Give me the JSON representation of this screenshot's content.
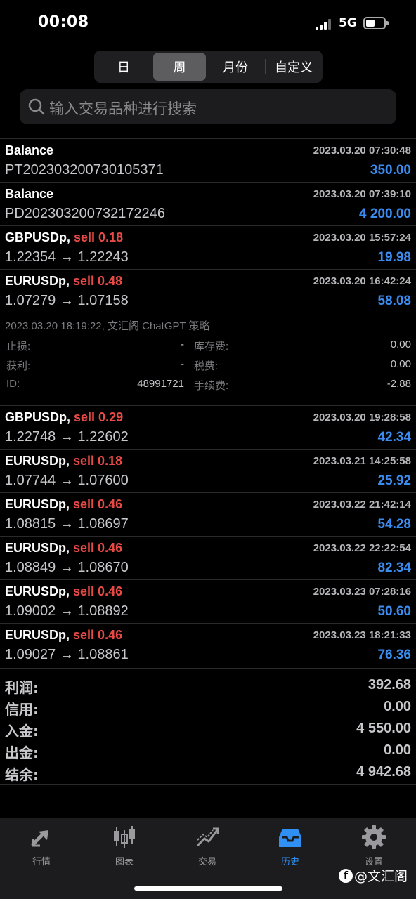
{
  "status": {
    "time": "00:08",
    "network": "5G"
  },
  "segments": [
    {
      "label": "日"
    },
    {
      "label": "周"
    },
    {
      "label": "月份"
    },
    {
      "label": "自定义"
    }
  ],
  "active_segment": "周",
  "search": {
    "placeholder": "输入交易品种进行搜索"
  },
  "rows": [
    {
      "symbol": "Balance",
      "side": "",
      "time": "2023.03.20 07:30:48",
      "sub": "PT202303200730105371",
      "value": "350.00"
    },
    {
      "symbol": "Balance",
      "side": "",
      "time": "2023.03.20 07:39:10",
      "sub": "PD202303200732172246",
      "value": "4 200.00"
    },
    {
      "symbol": "GBPUSDp,",
      "side": "sell 0.18",
      "time": "2023.03.20 15:57:24",
      "sub": "1.22354 → 1.22243",
      "value": "19.98"
    },
    {
      "symbol": "EURUSDp,",
      "side": "sell 0.48",
      "time": "2023.03.20 16:42:24",
      "sub": "1.07279 → 1.07158",
      "value": "58.08"
    }
  ],
  "detail": {
    "time_comment": "2023.03.20 18:19:22, 文汇阁 ChatGPT 策略",
    "sl_label": "止损:",
    "sl_value": "-",
    "swap_label": "库存费:",
    "swap_value": "0.00",
    "tp_label": "获利:",
    "tp_value": "-",
    "tax_label": "税费:",
    "tax_value": "0.00",
    "id_label": "ID:",
    "id_value": "48991721",
    "fee_label": "手续费:",
    "fee_value": "-2.88"
  },
  "rows2": [
    {
      "symbol": "GBPUSDp,",
      "side": "sell 0.29",
      "time": "2023.03.20 19:28:58",
      "sub": "1.22748 → 1.22602",
      "value": "42.34"
    },
    {
      "symbol": "EURUSDp,",
      "side": "sell 0.18",
      "time": "2023.03.21 14:25:58",
      "sub": "1.07744 → 1.07600",
      "value": "25.92"
    },
    {
      "symbol": "EURUSDp,",
      "side": "sell 0.46",
      "time": "2023.03.22 21:42:14",
      "sub": "1.08815 → 1.08697",
      "value": "54.28"
    },
    {
      "symbol": "EURUSDp,",
      "side": "sell 0.46",
      "time": "2023.03.22 22:22:54",
      "sub": "1.08849 → 1.08670",
      "value": "82.34"
    },
    {
      "symbol": "EURUSDp,",
      "side": "sell 0.46",
      "time": "2023.03.23 07:28:16",
      "sub": "1.09002 → 1.08892",
      "value": "50.60"
    },
    {
      "symbol": "EURUSDp,",
      "side": "sell 0.46",
      "time": "2023.03.23 18:21:33",
      "sub": "1.09027 → 1.08861",
      "value": "76.36"
    }
  ],
  "summary": [
    {
      "label": "利润:",
      "value": "392.68"
    },
    {
      "label": "信用:",
      "value": "0.00"
    },
    {
      "label": "入金:",
      "value": "4 550.00"
    },
    {
      "label": "出金:",
      "value": "0.00"
    },
    {
      "label": "结余:",
      "value": "4 942.68"
    }
  ],
  "tabs": [
    {
      "label": "行情",
      "icon": "quotes-icon"
    },
    {
      "label": "图表",
      "icon": "chart-icon"
    },
    {
      "label": "交易",
      "icon": "trade-icon"
    },
    {
      "label": "历史",
      "icon": "history-icon"
    },
    {
      "label": "设置",
      "icon": "settings-icon"
    }
  ],
  "active_tab": "历史",
  "watermark": "@文汇阁",
  "colors": {
    "accent": "#2f8ff2",
    "sell": "#e94a46",
    "profit": "#3b8cf0",
    "background": "#000000"
  }
}
